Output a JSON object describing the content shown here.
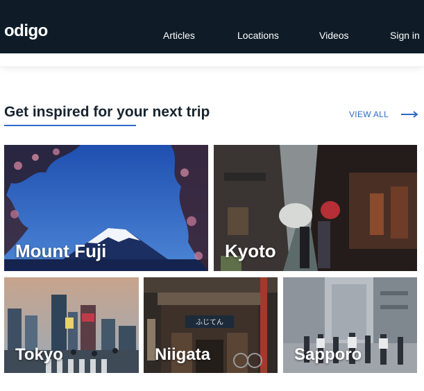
{
  "header": {
    "logo": "odigo",
    "nav": [
      {
        "label": "Articles"
      },
      {
        "label": "Locations"
      },
      {
        "label": "Videos"
      },
      {
        "label": "Sign in"
      }
    ]
  },
  "section": {
    "title": "Get inspired for your next trip",
    "view_all_label": "VIEW ALL"
  },
  "destinations": [
    {
      "name": "Mount Fuji"
    },
    {
      "name": "Kyoto"
    },
    {
      "name": "Tokyo"
    },
    {
      "name": "Niigata"
    },
    {
      "name": "Sapporo"
    }
  ],
  "colors": {
    "header_bg": "#0f1c28",
    "accent": "#2c6ac7",
    "title_text": "#17242f"
  }
}
